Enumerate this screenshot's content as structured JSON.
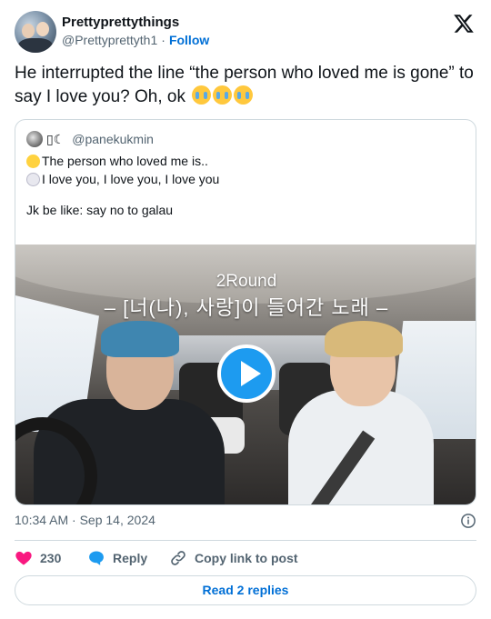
{
  "author": {
    "display_name": "Prettyprettythings",
    "handle": "@Prettyprettyth1",
    "separator": "·",
    "follow_label": "Follow"
  },
  "tweet": {
    "text": "He interrupted the line “the person who loved me is gone” to say I love you? Oh, ok",
    "emojis": [
      "loudly-crying-face",
      "loudly-crying-face",
      "loudly-crying-face"
    ]
  },
  "quoted_tweet": {
    "glyph": "▯☾",
    "handle": "@panekukmin",
    "lines": [
      "The person who loved me is..",
      "I love you, I love you, I love you",
      "Jk be like: say no to galau"
    ],
    "line_emojis": [
      "baby-chick",
      "rabbit-face"
    ],
    "video": {
      "overlay_line_1": "2Round",
      "overlay_line_2": "– [너(나), 사랑]이 들어간 노래 –"
    }
  },
  "timestamp": "10:34 AM · Sep 14, 2024",
  "actions": {
    "like_count": "230",
    "reply_label": "Reply",
    "copy_label": "Copy link to post"
  },
  "read_replies_label": "Read 2 replies",
  "colors": {
    "accent": "#1d9bf0",
    "link": "#006fd6",
    "like": "#f91880",
    "text": "#0f1419",
    "muted": "#536471",
    "border": "#cfd9de"
  }
}
